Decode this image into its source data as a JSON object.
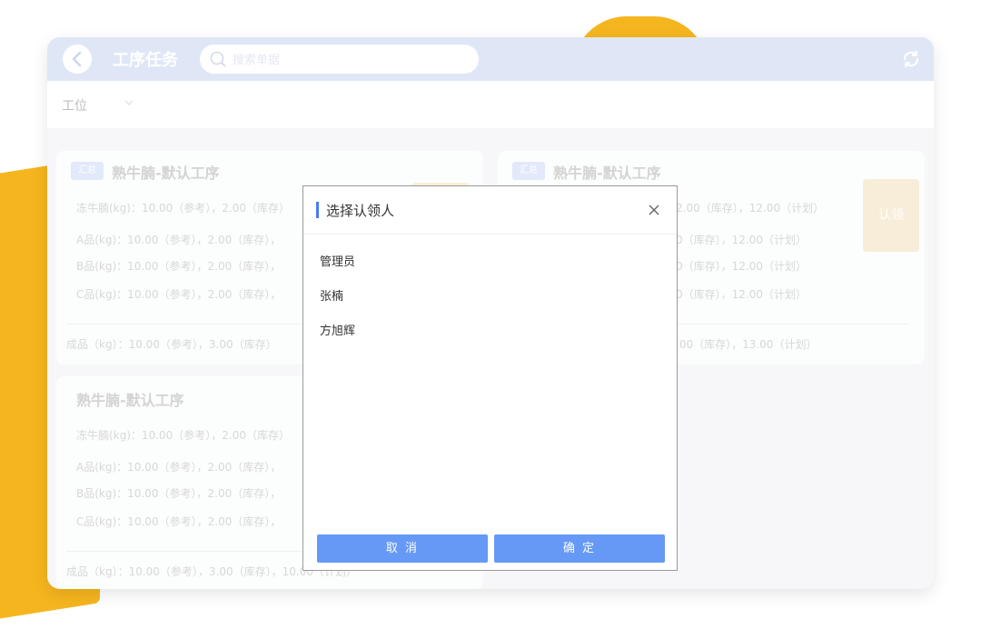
{
  "header": {
    "title": "工序任务",
    "search_placeholder": "搜索单据"
  },
  "filter": {
    "label": "工位"
  },
  "cards": [
    {
      "tag": "汇总",
      "title": "熟牛腩-默认工序",
      "rows": [
        "冻牛腩(kg)：10.00（参考），2.00（库存）",
        "A品(kg)：10.00（参考），2.00（库存），",
        "B品(kg)：10.00（参考），2.00（库存），",
        "C品(kg)：10.00（参考），2.00（库存），"
      ],
      "footer": "成品（kg）：10.00（参考），3.00（库存）"
    },
    {
      "tag": "汇总",
      "title": "熟牛腩-默认工序",
      "rows": [
        "2.00（库存），12.00（计划）",
        "0（库存），12.00（计划）",
        "0（库存），12.00（计划）",
        "0（库存），12.00（计划）"
      ],
      "footer": ".00（库存），13.00（计划）",
      "claim_label": "认领"
    },
    {
      "title": "熟牛腩-默认工序",
      "rows": [
        "冻牛腩(kg)：10.00（参考），2.00（库存）",
        "A品(kg)：10.00（参考），2.00（库存），",
        "B品(kg)：10.00（参考），2.00（库存），",
        "C品(kg)：10.00（参考），2.00（库存），"
      ],
      "footer": "成品（kg）：10.00（参考），3.00（库存），10.00（计划）"
    }
  ],
  "modal": {
    "title": "选择认领人",
    "options": [
      "管理员",
      "张楠",
      "方旭辉"
    ],
    "cancel_label": "取 消",
    "confirm_label": "确 定"
  },
  "colors": {
    "accent": "#6699f5",
    "header": "#c5d3f1",
    "decor": "#f5b51e"
  }
}
